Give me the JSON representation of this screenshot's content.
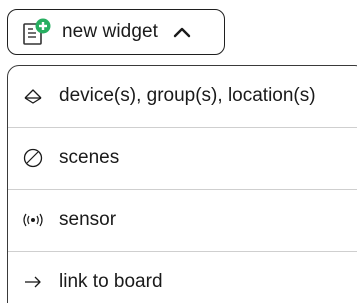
{
  "widget_button": {
    "label": "new widget",
    "icon": "add-widget-icon",
    "chevron_icon": "chevron-up-icon",
    "accent_color": "#27ae60"
  },
  "menu": {
    "items": [
      {
        "label": "device(s), group(s), location(s)",
        "icon": "device-group-icon"
      },
      {
        "label": "scenes",
        "icon": "scene-icon"
      },
      {
        "label": "sensor",
        "icon": "sensor-icon"
      },
      {
        "label": "link to board",
        "icon": "arrow-right-icon"
      }
    ]
  }
}
